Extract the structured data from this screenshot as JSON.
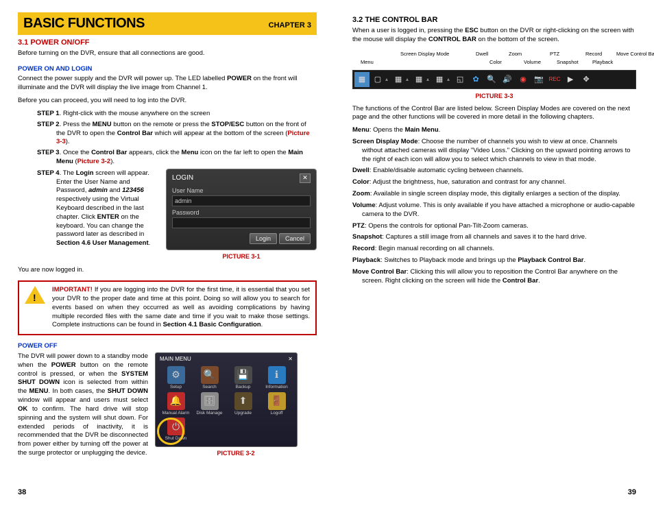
{
  "left": {
    "chapterTitle": "BASIC FUNCTIONS",
    "chapterNum": "CHAPTER 3",
    "sec31": "3.1 POWER ON/OFF",
    "intro": "Before turning on the DVR, ensure that all connections are good.",
    "subPowerOn": "POWER ON AND LOGIN",
    "p1a": "Connect the power supply and the DVR will power up. The LED labelled ",
    "p1b": "POWER",
    "p1c": " on the front will illuminate and the DVR will display the live image from Channel 1.",
    "p2": "Before you can proceed, you will need to log into the DVR.",
    "step1a": "STEP 1",
    "step1b": ". Right-click with the mouse anywhere on the screen",
    "step2a": "STEP 2",
    "step2b": ". Press the ",
    "step2c": "MENU",
    "step2d": " button on the remote or press the ",
    "step2e": "STOP/ESC",
    "step2f": " button on the front of the DVR to open the ",
    "step2g": "Control Bar",
    "step2h": " which will appear at the bottom of the screen (",
    "step2i": "Picture 3-3",
    "step2j": ").",
    "step3a": "STEP 3",
    "step3b": ". Once the ",
    "step3c": "Control Bar",
    "step3d": " appears, click the ",
    "step3e": "Menu",
    "step3f": " icon on the far left to open the ",
    "step3g": "Main Menu",
    "step3h": " (",
    "step3i": "Picture 3-2",
    "step3j": ").",
    "step4a": "STEP 4",
    "step4b": ". The ",
    "step4c": "Login",
    "step4d": " screen will appear. Enter the User Name and Password, ",
    "step4e": "admin",
    "step4f": " and ",
    "step4g": "123456",
    "step4h": " respectively using the Virtual Keyboard described in the last chapter. Click ",
    "step4i": "ENTER",
    "step4j": " on the keyboard. You can change the password later as described in ",
    "step4k": "Section 4.6 User Management",
    "step4l": ".",
    "login": {
      "title": "LOGIN",
      "userLbl": "User Name",
      "userVal": "admin",
      "passLbl": "Password",
      "btnLogin": "Login",
      "btnCancel": "Cancel"
    },
    "pic31": "PICTURE 3-1",
    "logged": "You are now logged in.",
    "warn": {
      "imp": "IMPORTANT!",
      "t1": " If you are logging into the DVR for the first time, it is essential that you set your DVR to the proper date and time at this point. Doing so will allow you to search for events based on when they occurred as well as avoiding complications by having multiple recorded files with the same date and time if you wait to make those settings. Complete instructions can be found in ",
      "t2": "Section 4.1 Basic Configuration",
      "t3": "."
    },
    "subPowerOff": "POWER OFF",
    "po1": "The DVR will power down to a standby mode when the ",
    "po2": "POWER",
    "po3": " button on the remote control is pressed, or when the ",
    "po4": "SYSTEM SHUT DOWN",
    "po5": " icon is selected from within the ",
    "po6": "MENU",
    "po7": ". In both cases, the ",
    "po8": "SHUT DOWN",
    "po9": " window will appear and users must select ",
    "po10": "OK",
    "po11": " to confirm. The hard drive will stop spinning and the system will shut down. For extended periods of inactivity, it is recommended that the DVR be disconnected from power either by turning off the power at the surge protector or unplugging the device.",
    "menu": {
      "title": "MAIN MENU",
      "items": [
        "Setup",
        "Search",
        "Backup",
        "Information",
        "Manual Alarm",
        "Disk Manage",
        "Upgrade",
        "Logoff",
        "Shut Down"
      ]
    },
    "pic32": "PICTURE 3-2",
    "pageNum": "38"
  },
  "right": {
    "sec32": "3.2 THE CONTROL BAR",
    "intro1": "When a user is logged in, pressing the ",
    "intro2": "ESC",
    "intro3": " button on the DVR or right-clicking on the screen with the mouse will display the ",
    "intro4": "CONTROL BAR",
    "intro5": " on the bottom of the screen.",
    "labels": {
      "menu": "Menu",
      "sdm": "Screen Display Mode",
      "dwell": "Dwell",
      "color": "Color",
      "zoom": "Zoom",
      "volume": "Volume",
      "ptz": "PTZ",
      "snapshot": "Snapshot",
      "record": "Record",
      "playback": "Playback",
      "move": "Move Control Bar"
    },
    "pic33": "PICTURE 3-3",
    "p1": "The functions of the Control Bar are listed below. Screen Display Modes are covered on the next page and the other functions will be covered in more detail in the following chapters.",
    "defs": {
      "menu1": "Menu",
      "menu2": ": Opens the ",
      "menu3": "Main Menu",
      "menu4": ".",
      "sdm1": "Screen Display Mode",
      "sdm2": ": Choose the number of channels you wish to view at once. Channels without attached cameras will display \"Video Loss.\" Clicking on the upward pointing arrows to the right of each icon will allow you to select which channels to view in that mode.",
      "dwell1": "Dwell",
      "dwell2": ": Enable/disable automatic cycling between channels.",
      "color1": "Color",
      "color2": ": Adjust the brightness, hue, saturation and contrast for any channel.",
      "zoom1": "Zoom",
      "zoom2": ": Available in single screen display mode, this digitally enlarges a section of the display.",
      "vol1": "Volume",
      "vol2": ": Adjust volume. This is only available if you have attached a microphone or audio-capable camera to the DVR.",
      "ptz1": "PTZ",
      "ptz2": ": Opens the controls for optional Pan-Tilt-Zoom cameras.",
      "snap1": "Snapshot",
      "snap2": ": Captures a still image from all channels and saves it to the hard drive.",
      "rec1": "Record",
      "rec2": ": Begin manual recording on all channels.",
      "pb1": "Playback",
      "pb2": ": Switches to Playback mode and brings up the ",
      "pb3": "Playback Control Bar",
      "pb4": ".",
      "mv1": "Move Control Bar",
      "mv2": ": Clicking this will allow you to reposition the Control Bar anywhere on the screen. Right clicking on the screen will hide the ",
      "mv3": "Control Bar",
      "mv4": "."
    },
    "pageNum": "39"
  }
}
